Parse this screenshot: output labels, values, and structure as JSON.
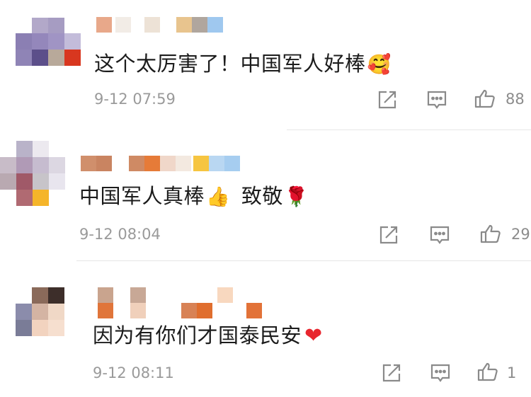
{
  "comments": [
    {
      "text": "这个太厉害了！中国军人好棒",
      "emoji": "🥰",
      "time": "9-12 07:59",
      "likes": "88",
      "actions": [
        "forward-icon",
        "comment-icon",
        "like-icon"
      ]
    },
    {
      "text": "中国军人真棒",
      "emoji": "👍",
      "text2": "致敬",
      "emoji2": "🌹",
      "time": "9-12 08:04",
      "likes": "29",
      "actions": [
        "forward-icon",
        "comment-icon",
        "like-icon"
      ]
    },
    {
      "text": "因为有你们才国泰民安",
      "emoji": "❤",
      "time": "9-12 08:11",
      "likes": "1",
      "actions": [
        "forward-icon",
        "comment-icon",
        "like-icon"
      ]
    }
  ],
  "colors": {
    "text": "#1c1c1c",
    "meta": "#9a9a9a",
    "icon": "#8a8a8a",
    "divider": "#e6e6e6",
    "heart": "#e8262e"
  }
}
